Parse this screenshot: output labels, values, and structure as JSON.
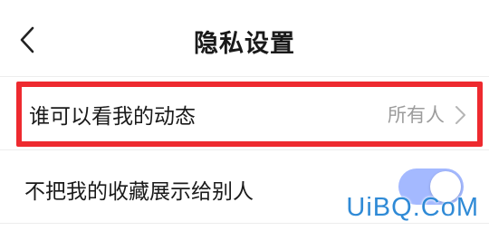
{
  "header": {
    "title": "隐私设置",
    "back_icon": "chevron-left-icon"
  },
  "rows": [
    {
      "label": "谁可以看我的动态",
      "value": "所有人",
      "icon": "chevron-right-icon",
      "highlighted": true,
      "highlight_color": "#ee2a2f"
    },
    {
      "label": "不把我的收藏展示给别人",
      "toggle_on": true,
      "toggle_color": "#a4b9ff"
    }
  ],
  "watermark": "UiBQ.CoM"
}
